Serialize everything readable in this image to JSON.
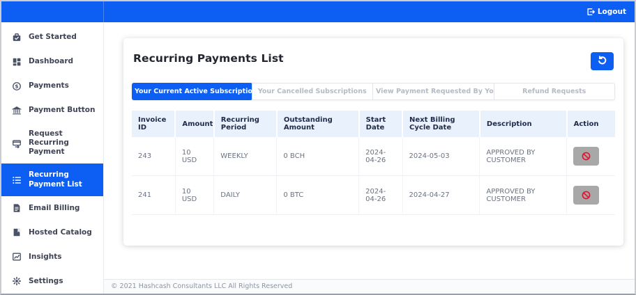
{
  "topbar": {
    "logout_label": "Logout"
  },
  "sidebar": {
    "items": [
      {
        "label": "Get Started",
        "icon": "get-started-icon",
        "active": false
      },
      {
        "label": "Dashboard",
        "icon": "dashboard-icon",
        "active": false
      },
      {
        "label": "Payments",
        "icon": "payments-icon",
        "active": false
      },
      {
        "label": "Payment Button",
        "icon": "payment-button-icon",
        "active": false
      },
      {
        "label": "Request Recurring Payment",
        "icon": "request-recurring-payment-icon",
        "active": false
      },
      {
        "label": "Recurring Payment List",
        "icon": "recurring-payment-list-icon",
        "active": true
      },
      {
        "label": "Email Billing",
        "icon": "email-billing-icon",
        "active": false
      },
      {
        "label": "Hosted Catalog",
        "icon": "hosted-catalog-icon",
        "active": false
      },
      {
        "label": "Insights",
        "icon": "insights-icon",
        "active": false
      },
      {
        "label": "Settings",
        "icon": "settings-icon",
        "active": false
      }
    ]
  },
  "main": {
    "title": "Recurring Payments List",
    "history_button_icon": "history-icon",
    "tabs": [
      {
        "label": "Your Current Active Subscriptions",
        "active": true
      },
      {
        "label": "Your Cancelled Subscriptions",
        "active": false
      },
      {
        "label": "View Payment Requested By You",
        "active": false
      },
      {
        "label": "Refund Requests",
        "active": false
      }
    ],
    "table": {
      "columns": [
        "Invoice ID",
        "Amount",
        "Recurring Period",
        "Outstanding Amount",
        "Start Date",
        "Next Billing Cycle Date",
        "Description",
        "Action"
      ],
      "rows": [
        {
          "invoice_id": "243",
          "amount": "10 USD",
          "recurring_period": "WEEKLY",
          "outstanding_amount": "0 BCH",
          "start_date": "2024-04-26",
          "next_billing_cycle_date": "2024-05-03",
          "description": "APPROVED BY CUSTOMER",
          "action_icon": "ban-icon"
        },
        {
          "invoice_id": "241",
          "amount": "10 USD",
          "recurring_period": "DAILY",
          "outstanding_amount": "0 BTC",
          "start_date": "2024-04-26",
          "next_billing_cycle_date": "2024-04-27",
          "description": "APPROVED BY CUSTOMER",
          "action_icon": "ban-icon"
        }
      ]
    },
    "footer": "© 2021 Hashcash Consultants LLC All Rights Reserved"
  },
  "colors": {
    "primary_blue": "#0d5ef2",
    "table_header_bg": "#e9f2fc",
    "action_button_gray": "#a8a8a8",
    "ban_red": "#e8112d",
    "sidebar_text": "#3f4455",
    "inactive_tab_text": "#b4bbc7"
  }
}
